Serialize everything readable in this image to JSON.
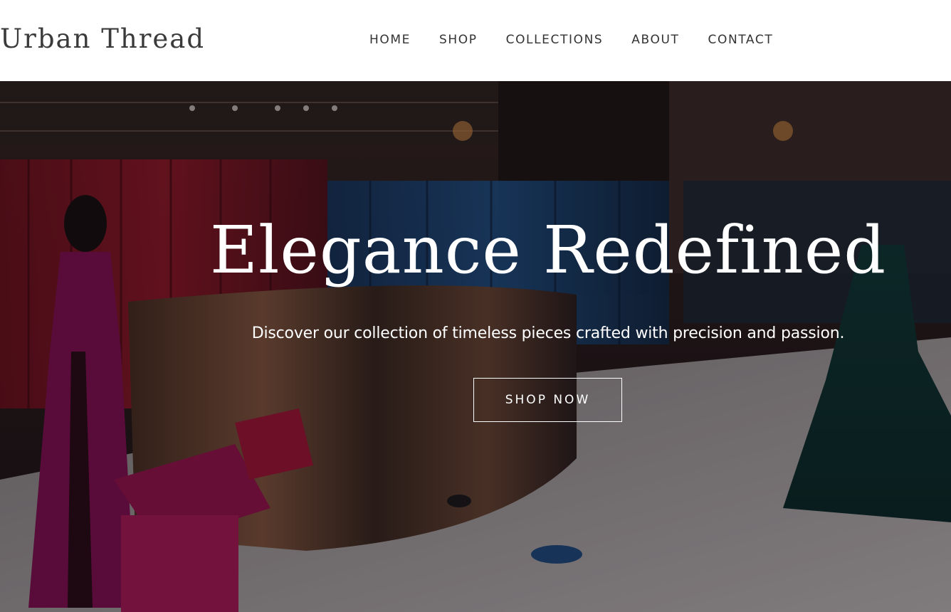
{
  "header": {
    "logo_text": "Urban Thread",
    "nav": [
      {
        "label": "HOME"
      },
      {
        "label": "SHOP"
      },
      {
        "label": "COLLECTIONS"
      },
      {
        "label": "ABOUT"
      },
      {
        "label": "CONTACT"
      }
    ]
  },
  "hero": {
    "title": "Elegance Redefined",
    "subtitle": "Discover our collection of timeless pieces crafted with precision and passion.",
    "cta_label": "SHOP NOW",
    "background_image": "boutique-interior-photo"
  },
  "colors": {
    "header_bg": "#ffffff",
    "logo_text": "#3a3a3a",
    "nav_text": "#333333",
    "hero_text": "#ffffff",
    "hero_overlay": "#0a0608"
  }
}
